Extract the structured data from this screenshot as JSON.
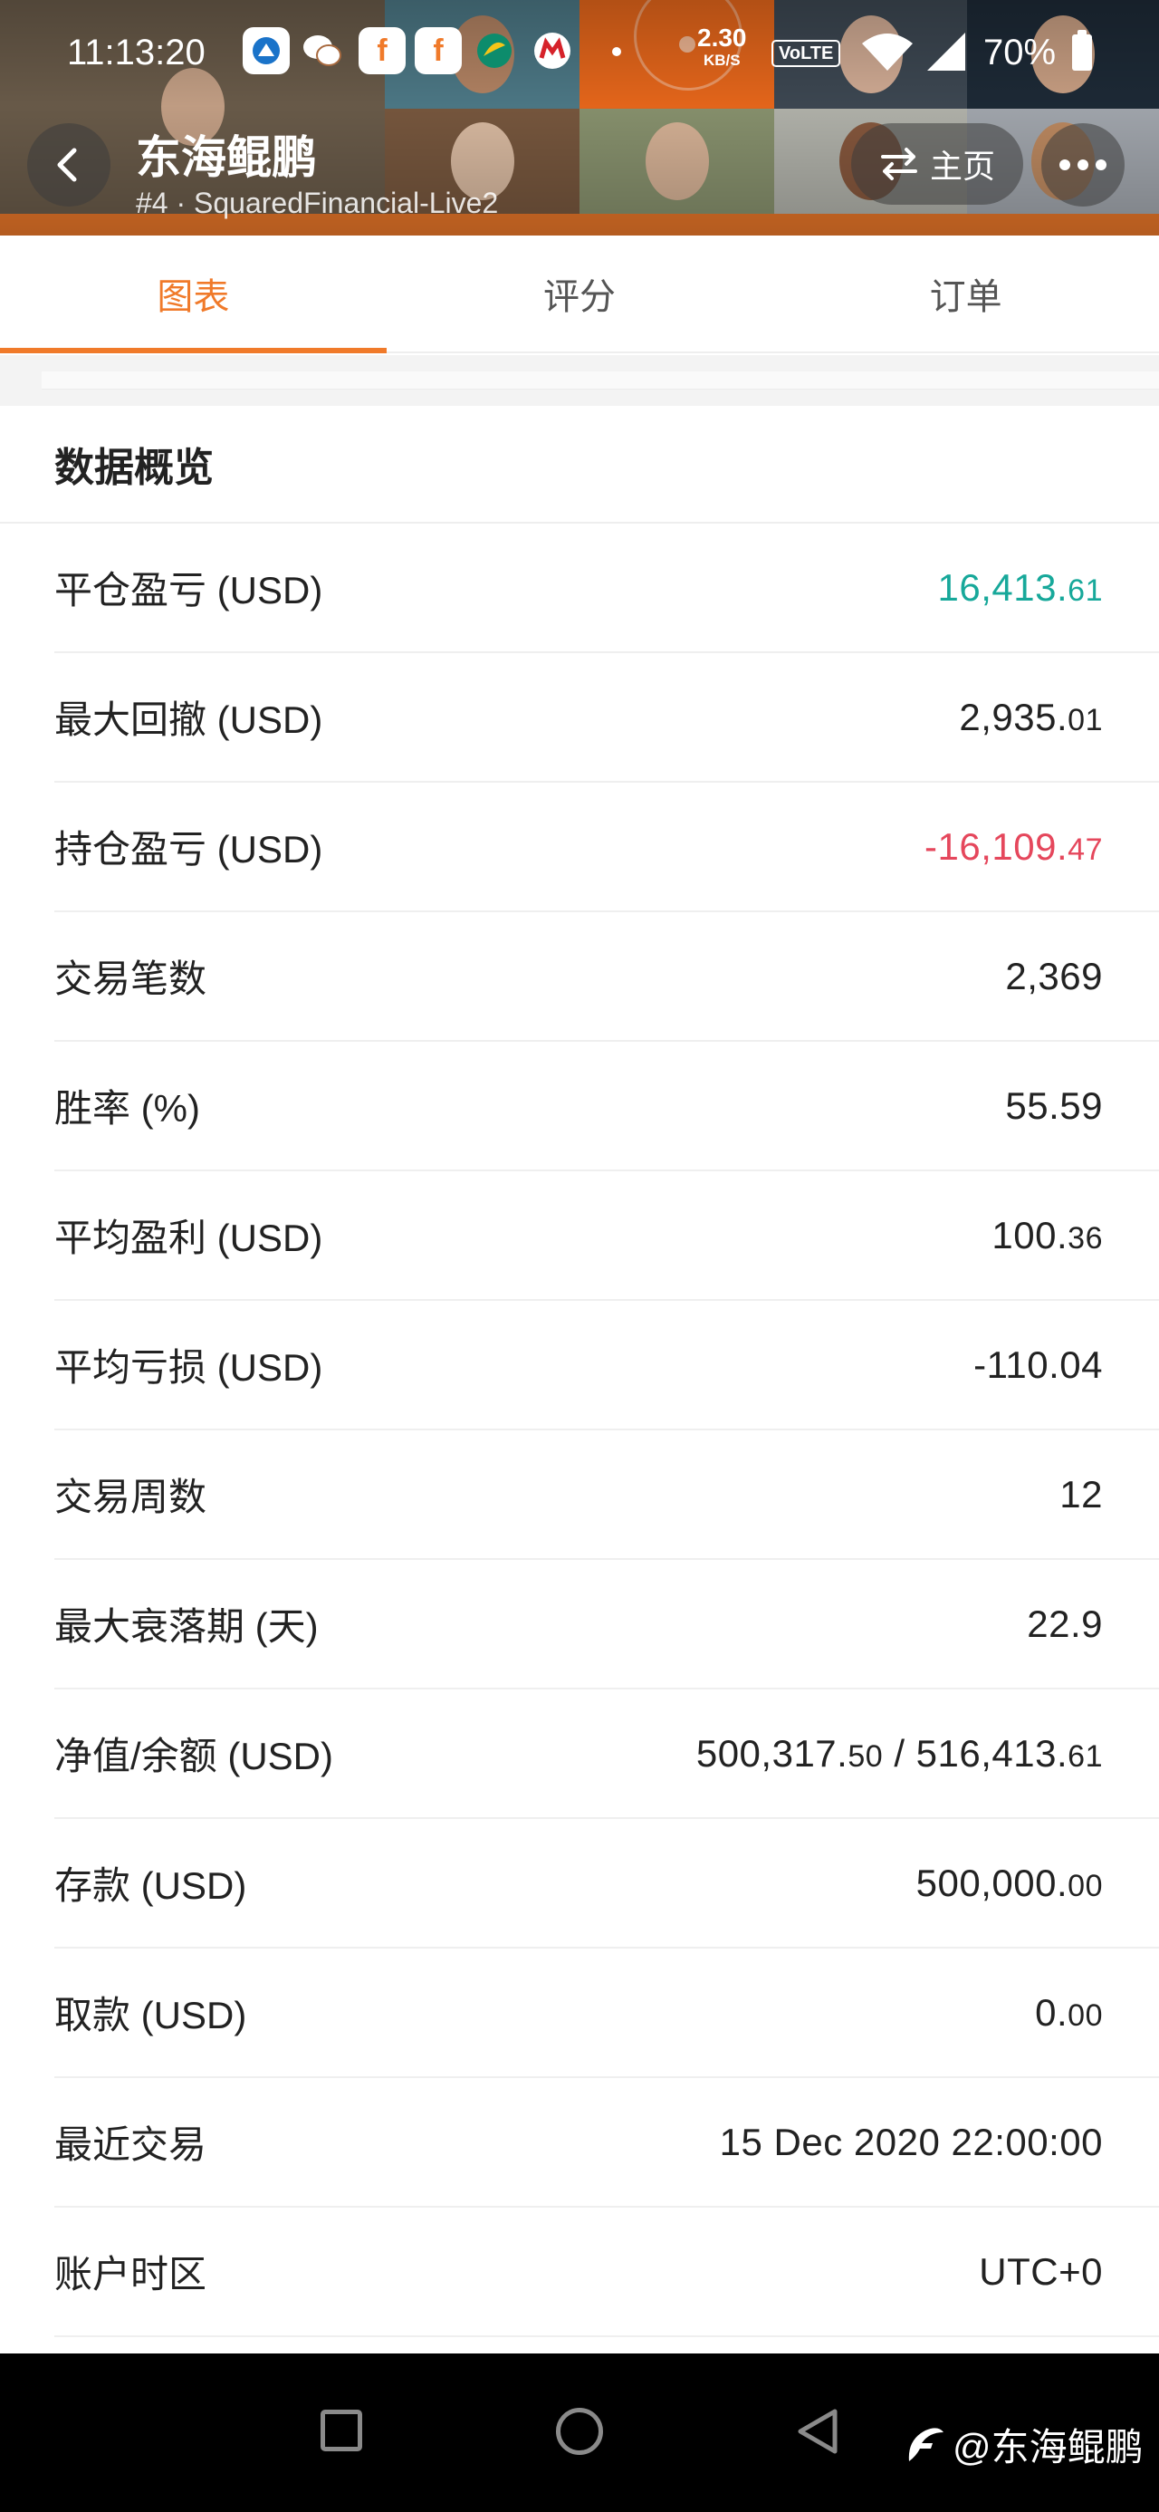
{
  "status_bar": {
    "time": "11:13:20",
    "net_speed_value": "2.30",
    "net_speed_unit": "KB/S",
    "volte": "VoLTE",
    "battery": "70%",
    "app_icons": [
      "maps-icon",
      "wechat-icon",
      "f-app-icon",
      "f-app-icon",
      "leaf-app-icon",
      "cmb-bank-icon"
    ]
  },
  "header": {
    "title": "东海鲲鹏",
    "subtitle": "#4 · SquaredFinancial-Live2",
    "home_label": "主页"
  },
  "tabs": [
    {
      "label": "图表",
      "active": true
    },
    {
      "label": "评分",
      "active": false
    },
    {
      "label": "订单",
      "active": false
    }
  ],
  "overview": {
    "title": "数据概览",
    "rows": [
      {
        "label": "平仓盈亏 (USD)",
        "int": "16,413.",
        "dec": "61",
        "color": "#17a89a"
      },
      {
        "label": "最大回撤 (USD)",
        "int": "2,935.",
        "dec": "01",
        "color": "#222222"
      },
      {
        "label": "持仓盈亏 (USD)",
        "int": "-16,109.",
        "dec": "47",
        "color": "#e5475c"
      },
      {
        "label": "交易笔数",
        "int": "2,369",
        "dec": "",
        "color": "#222222"
      },
      {
        "label": "胜率 (%)",
        "int": "55.59",
        "dec": "",
        "color": "#222222"
      },
      {
        "label": "平均盈利 (USD)",
        "int": "100.",
        "dec": "36",
        "color": "#222222"
      },
      {
        "label": "平均亏损 (USD)",
        "int": "-110.04",
        "dec": "",
        "color": "#222222"
      },
      {
        "label": "交易周数",
        "int": "12",
        "dec": "",
        "color": "#222222"
      },
      {
        "label": "最大衰落期 (天)",
        "int": "22.9",
        "dec": "",
        "color": "#222222"
      },
      {
        "label": "净值/余额 (USD)",
        "int": "500,317.",
        "dec": "50",
        "int2": " / 516,413.",
        "dec2": "61",
        "color": "#222222"
      },
      {
        "label": "存款 (USD)",
        "int": "500,000.",
        "dec": "00",
        "color": "#222222"
      },
      {
        "label": "取款 (USD)",
        "int": "0.",
        "dec": "00",
        "color": "#222222"
      },
      {
        "label": "最近交易",
        "int": "15 Dec 2020 22:00:00",
        "dec": "",
        "color": "#222222"
      },
      {
        "label": "账户时区",
        "int": "UTC+0",
        "dec": "",
        "color": "#222222"
      }
    ]
  },
  "watermark": "@东海鲲鹏",
  "colors": {
    "accent": "#f07a2a",
    "positive": "#17a89a",
    "negative": "#e5475c"
  }
}
